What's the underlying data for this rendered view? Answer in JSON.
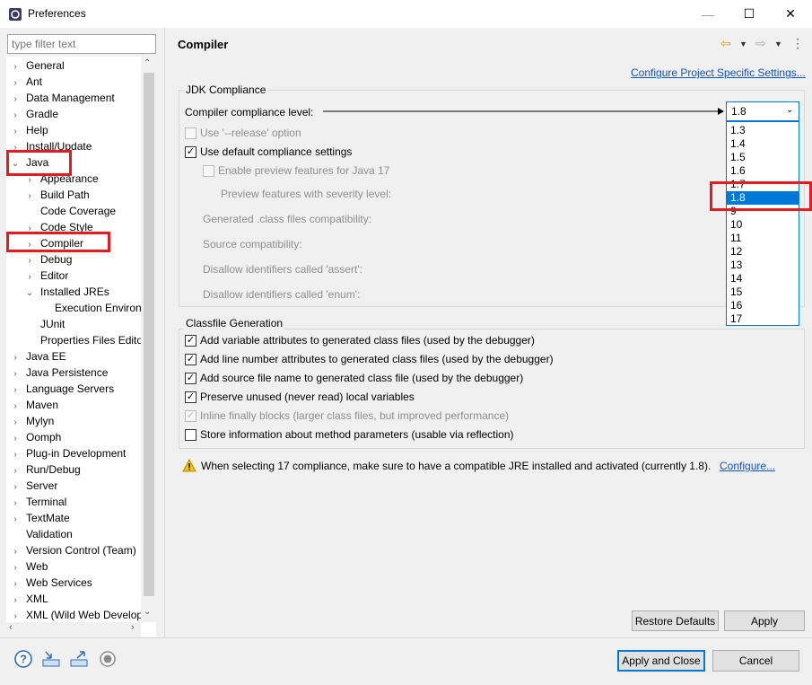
{
  "window": {
    "title": "Preferences",
    "minimize": "—",
    "maximize": "☐",
    "close": "✕"
  },
  "filter": {
    "placeholder": "type filter text"
  },
  "tree": [
    {
      "label": "General",
      "arrow": "›",
      "indent": 0
    },
    {
      "label": "Ant",
      "arrow": "›",
      "indent": 0
    },
    {
      "label": "Data Management",
      "arrow": "›",
      "indent": 0
    },
    {
      "label": "Gradle",
      "arrow": "›",
      "indent": 0
    },
    {
      "label": "Help",
      "arrow": "›",
      "indent": 0
    },
    {
      "label": "Install/Update",
      "arrow": "›",
      "indent": 0
    },
    {
      "label": "Java",
      "arrow": "⌄",
      "indent": 0
    },
    {
      "label": "Appearance",
      "arrow": "›",
      "indent": 1
    },
    {
      "label": "Build Path",
      "arrow": "›",
      "indent": 1
    },
    {
      "label": "Code Coverage",
      "arrow": "",
      "indent": 1
    },
    {
      "label": "Code Style",
      "arrow": "›",
      "indent": 1
    },
    {
      "label": "Compiler",
      "arrow": "›",
      "indent": 1
    },
    {
      "label": "Debug",
      "arrow": "›",
      "indent": 1
    },
    {
      "label": "Editor",
      "arrow": "›",
      "indent": 1
    },
    {
      "label": "Installed JREs",
      "arrow": "⌄",
      "indent": 1
    },
    {
      "label": "Execution Environ",
      "arrow": "",
      "indent": 2
    },
    {
      "label": "JUnit",
      "arrow": "",
      "indent": 1
    },
    {
      "label": "Properties Files Edito",
      "arrow": "",
      "indent": 1
    },
    {
      "label": "Java EE",
      "arrow": "›",
      "indent": 0
    },
    {
      "label": "Java Persistence",
      "arrow": "›",
      "indent": 0
    },
    {
      "label": "Language Servers",
      "arrow": "›",
      "indent": 0
    },
    {
      "label": "Maven",
      "arrow": "›",
      "indent": 0
    },
    {
      "label": "Mylyn",
      "arrow": "›",
      "indent": 0
    },
    {
      "label": "Oomph",
      "arrow": "›",
      "indent": 0
    },
    {
      "label": "Plug-in Development",
      "arrow": "›",
      "indent": 0
    },
    {
      "label": "Run/Debug",
      "arrow": "›",
      "indent": 0
    },
    {
      "label": "Server",
      "arrow": "›",
      "indent": 0
    },
    {
      "label": "Terminal",
      "arrow": "›",
      "indent": 0
    },
    {
      "label": "TextMate",
      "arrow": "›",
      "indent": 0
    },
    {
      "label": "Validation",
      "arrow": "",
      "indent": 0
    },
    {
      "label": "Version Control (Team)",
      "arrow": "›",
      "indent": 0
    },
    {
      "label": "Web",
      "arrow": "›",
      "indent": 0
    },
    {
      "label": "Web Services",
      "arrow": "›",
      "indent": 0
    },
    {
      "label": "XML",
      "arrow": "›",
      "indent": 0
    },
    {
      "label": "XML (Wild Web Develop",
      "arrow": "›",
      "indent": 0
    }
  ],
  "page": {
    "title": "Compiler",
    "configure_link": "Configure Project Specific Settings..."
  },
  "jdk": {
    "group_label": "JDK Compliance",
    "compliance_label": "Compiler compliance level:",
    "selected": "1.8",
    "options": [
      "1.3",
      "1.4",
      "1.5",
      "1.6",
      "1.7",
      "1.8",
      "9",
      "10",
      "11",
      "12",
      "13",
      "14",
      "15",
      "16",
      "17"
    ],
    "release_option": "Use '--release' option",
    "use_default": "Use default compliance settings",
    "enable_preview": "Enable preview features for Java 17",
    "preview_severity": "Preview features with severity level:",
    "generated_compat": "Generated .class files compatibility:",
    "source_compat": "Source compatibility:",
    "disallow_assert": "Disallow identifiers called 'assert':",
    "disallow_enum": "Disallow identifiers called 'enum':"
  },
  "classfile": {
    "group_label": "Classfile Generation",
    "items": [
      {
        "label": "Add variable attributes to generated class files (used by the debugger)",
        "checked": true,
        "disabled": false
      },
      {
        "label": "Add line number attributes to generated class files (used by the debugger)",
        "checked": true,
        "disabled": false
      },
      {
        "label": "Add source file name to generated class file (used by the debugger)",
        "checked": true,
        "disabled": false
      },
      {
        "label": "Preserve unused (never read) local variables",
        "checked": true,
        "disabled": false
      },
      {
        "label": "Inline finally blocks (larger class files, but improved performance)",
        "checked": true,
        "disabled": true
      },
      {
        "label": "Store information about method parameters (usable via reflection)",
        "checked": false,
        "disabled": false
      }
    ]
  },
  "warning": {
    "text": "When selecting 17 compliance, make sure to have a compatible JRE installed and activated (currently 1.8).",
    "link": "Configure..."
  },
  "buttons": {
    "restore_defaults": "Restore Defaults",
    "apply": "Apply",
    "apply_and_close": "Apply and Close",
    "cancel": "Cancel"
  },
  "colors": {
    "accent": "#0078d7",
    "highlight": "#e31c23",
    "link": "#0f54c4"
  }
}
